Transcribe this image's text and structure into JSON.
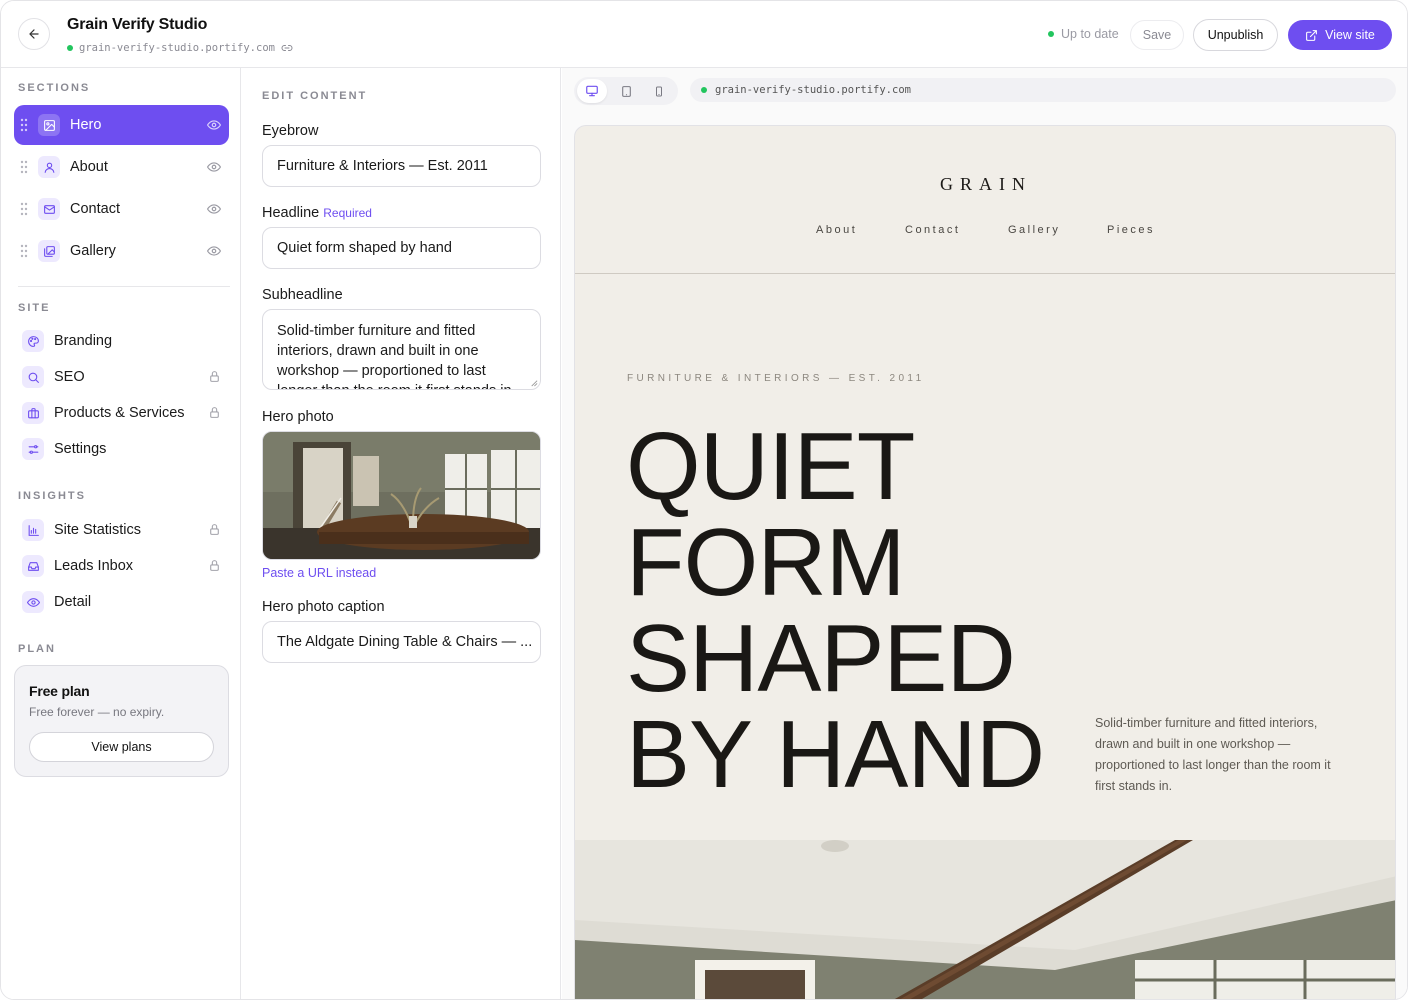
{
  "header": {
    "title": "Grain Verify Studio",
    "url": "grain-verify-studio.portify.com",
    "status": "Up to date",
    "save_label": "Save",
    "unpublish_label": "Unpublish",
    "view_site_label": "View site",
    "accent_color": "#6e4ef0",
    "status_color": "#22c55e"
  },
  "sidebar": {
    "sections_label": "SECTIONS",
    "sections": [
      {
        "label": "Hero",
        "icon": "image-icon",
        "active": true
      },
      {
        "label": "About",
        "icon": "user-icon",
        "active": false
      },
      {
        "label": "Contact",
        "icon": "mail-icon",
        "active": false
      },
      {
        "label": "Gallery",
        "icon": "gallery-icon",
        "active": false
      }
    ],
    "site_label": "SITE",
    "site_items": [
      {
        "label": "Branding",
        "icon": "palette-icon",
        "locked": false
      },
      {
        "label": "SEO",
        "icon": "search-icon",
        "locked": true
      },
      {
        "label": "Products & Services",
        "icon": "briefcase-icon",
        "locked": true
      },
      {
        "label": "Settings",
        "icon": "sliders-icon",
        "locked": false
      }
    ],
    "insights_label": "INSIGHTS",
    "insight_items": [
      {
        "label": "Site Statistics",
        "icon": "bar-chart-icon",
        "locked": true
      },
      {
        "label": "Leads Inbox",
        "icon": "inbox-icon",
        "locked": true
      },
      {
        "label": "Detail",
        "icon": "eye-icon",
        "locked": false
      }
    ],
    "plan_label": "PLAN",
    "plan": {
      "title": "Free plan",
      "subtitle": "Free forever — no expiry.",
      "button": "View plans"
    }
  },
  "editor": {
    "heading": "EDIT CONTENT",
    "eyebrow_label": "Eyebrow",
    "eyebrow_value": "Furniture & Interiors — Est. 2011",
    "headline_label": "Headline",
    "headline_required": "Required",
    "headline_value": "Quiet form shaped by hand",
    "subheadline_label": "Subheadline",
    "subheadline_value": "Solid-timber furniture and fitted interiors, drawn and built in one workshop — proportioned to last longer than the room it first stands in.",
    "photo_label": "Hero photo",
    "paste_url": "Paste a URL instead",
    "caption_label": "Hero photo caption",
    "caption_value": "The Aldgate Dining Table & Chairs — ..."
  },
  "preview": {
    "url": "grain-verify-studio.portify.com",
    "brand": "GRAIN",
    "nav": [
      "About",
      "Contact",
      "Gallery",
      "Pieces"
    ],
    "eyebrow": "FURNITURE & INTERIORS — EST. 2011",
    "headline_lines": [
      "QUIET",
      "FORM",
      "SHAPED",
      "BY HAND"
    ],
    "subheadline": "Solid-timber furniture and fitted interiors, drawn and built in one workshop — proportioned to last longer than the room it first stands in."
  }
}
